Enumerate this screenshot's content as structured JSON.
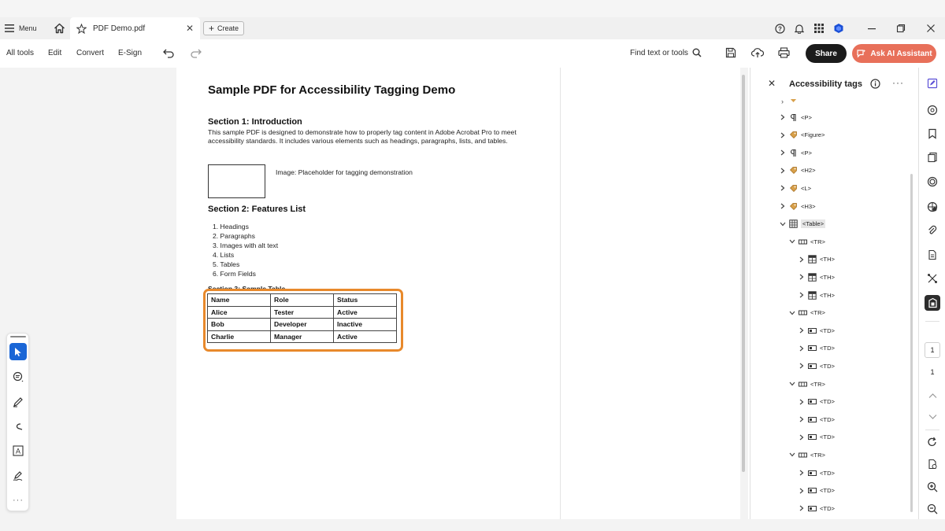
{
  "colors": {
    "accent_highlight": "#e8892b",
    "ai_button": "#e8705a",
    "share_button": "#1b1b1b",
    "tool_selected": "#1a66d6"
  },
  "tabbar": {
    "menu_label": "Menu",
    "tab_title": "PDF Demo.pdf",
    "create_label": "Create"
  },
  "toolbar": {
    "items": [
      "All tools",
      "Edit",
      "Convert",
      "E-Sign"
    ],
    "find_placeholder": "Find text or tools",
    "share_label": "Share",
    "ai_label": "Ask AI Assistant"
  },
  "document": {
    "title": "Sample PDF for Accessibility Tagging Demo",
    "section1_heading": "Section 1: Introduction",
    "section1_text": "This sample PDF is designed to demonstrate how to properly tag content in Adobe Acrobat Pro to meet accessibility standards. It includes various elements such as headings, paragraphs, lists, and tables.",
    "image_caption": "Image: Placeholder for tagging demonstration",
    "section2_heading": "Section 2: Features List",
    "features": [
      "1. Headings",
      "2. Paragraphs",
      "3. Images with alt text",
      "4. Lists",
      "5. Tables",
      "6. Form Fields"
    ],
    "section3_heading": "Section 3: Sample Table",
    "table": {
      "rows": [
        [
          "Name",
          "Role",
          "Status"
        ],
        [
          "Alice",
          "Tester",
          "Active"
        ],
        [
          "Bob",
          "Developer",
          "Inactive"
        ],
        [
          "Charlie",
          "Manager",
          "Active"
        ]
      ]
    }
  },
  "tags_panel": {
    "title": "Accessibility tags",
    "nodes": [
      {
        "label": "<P>",
        "icon": "paragraph-icon",
        "indent": 0,
        "expanded": false
      },
      {
        "label": "<Figure>",
        "icon": "tag-icon",
        "indent": 0,
        "expanded": false
      },
      {
        "label": "<P>",
        "icon": "paragraph-icon",
        "indent": 0,
        "expanded": false
      },
      {
        "label": "<H2>",
        "icon": "tag-icon",
        "indent": 0,
        "expanded": false
      },
      {
        "label": "<L>",
        "icon": "tag-icon",
        "indent": 0,
        "expanded": false
      },
      {
        "label": "<H3>",
        "icon": "tag-icon",
        "indent": 0,
        "expanded": false
      },
      {
        "label": "<Table>",
        "icon": "table-icon",
        "indent": 0,
        "expanded": true,
        "selected": true
      },
      {
        "label": "<TR>",
        "icon": "row-icon",
        "indent": 1,
        "expanded": true
      },
      {
        "label": "<TH>",
        "icon": "header-cell-icon",
        "indent": 2,
        "expanded": false
      },
      {
        "label": "<TH>",
        "icon": "header-cell-icon",
        "indent": 2,
        "expanded": false
      },
      {
        "label": "<TH>",
        "icon": "header-cell-icon",
        "indent": 2,
        "expanded": false
      },
      {
        "label": "<TR>",
        "icon": "row-icon",
        "indent": 1,
        "expanded": true
      },
      {
        "label": "<TD>",
        "icon": "cell-icon",
        "indent": 2,
        "expanded": false
      },
      {
        "label": "<TD>",
        "icon": "cell-icon",
        "indent": 2,
        "expanded": false
      },
      {
        "label": "<TD>",
        "icon": "cell-icon",
        "indent": 2,
        "expanded": false
      },
      {
        "label": "<TR>",
        "icon": "row-icon",
        "indent": 1,
        "expanded": true
      },
      {
        "label": "<TD>",
        "icon": "cell-icon",
        "indent": 2,
        "expanded": false
      },
      {
        "label": "<TD>",
        "icon": "cell-icon",
        "indent": 2,
        "expanded": false
      },
      {
        "label": "<TD>",
        "icon": "cell-icon",
        "indent": 2,
        "expanded": false
      },
      {
        "label": "<TR>",
        "icon": "row-icon",
        "indent": 1,
        "expanded": true
      },
      {
        "label": "<TD>",
        "icon": "cell-icon",
        "indent": 2,
        "expanded": false
      },
      {
        "label": "<TD>",
        "icon": "cell-icon",
        "indent": 2,
        "expanded": false
      },
      {
        "label": "<TD>",
        "icon": "cell-icon",
        "indent": 2,
        "expanded": false
      }
    ]
  },
  "rail": {
    "page_current": "1",
    "page_total": "1"
  }
}
